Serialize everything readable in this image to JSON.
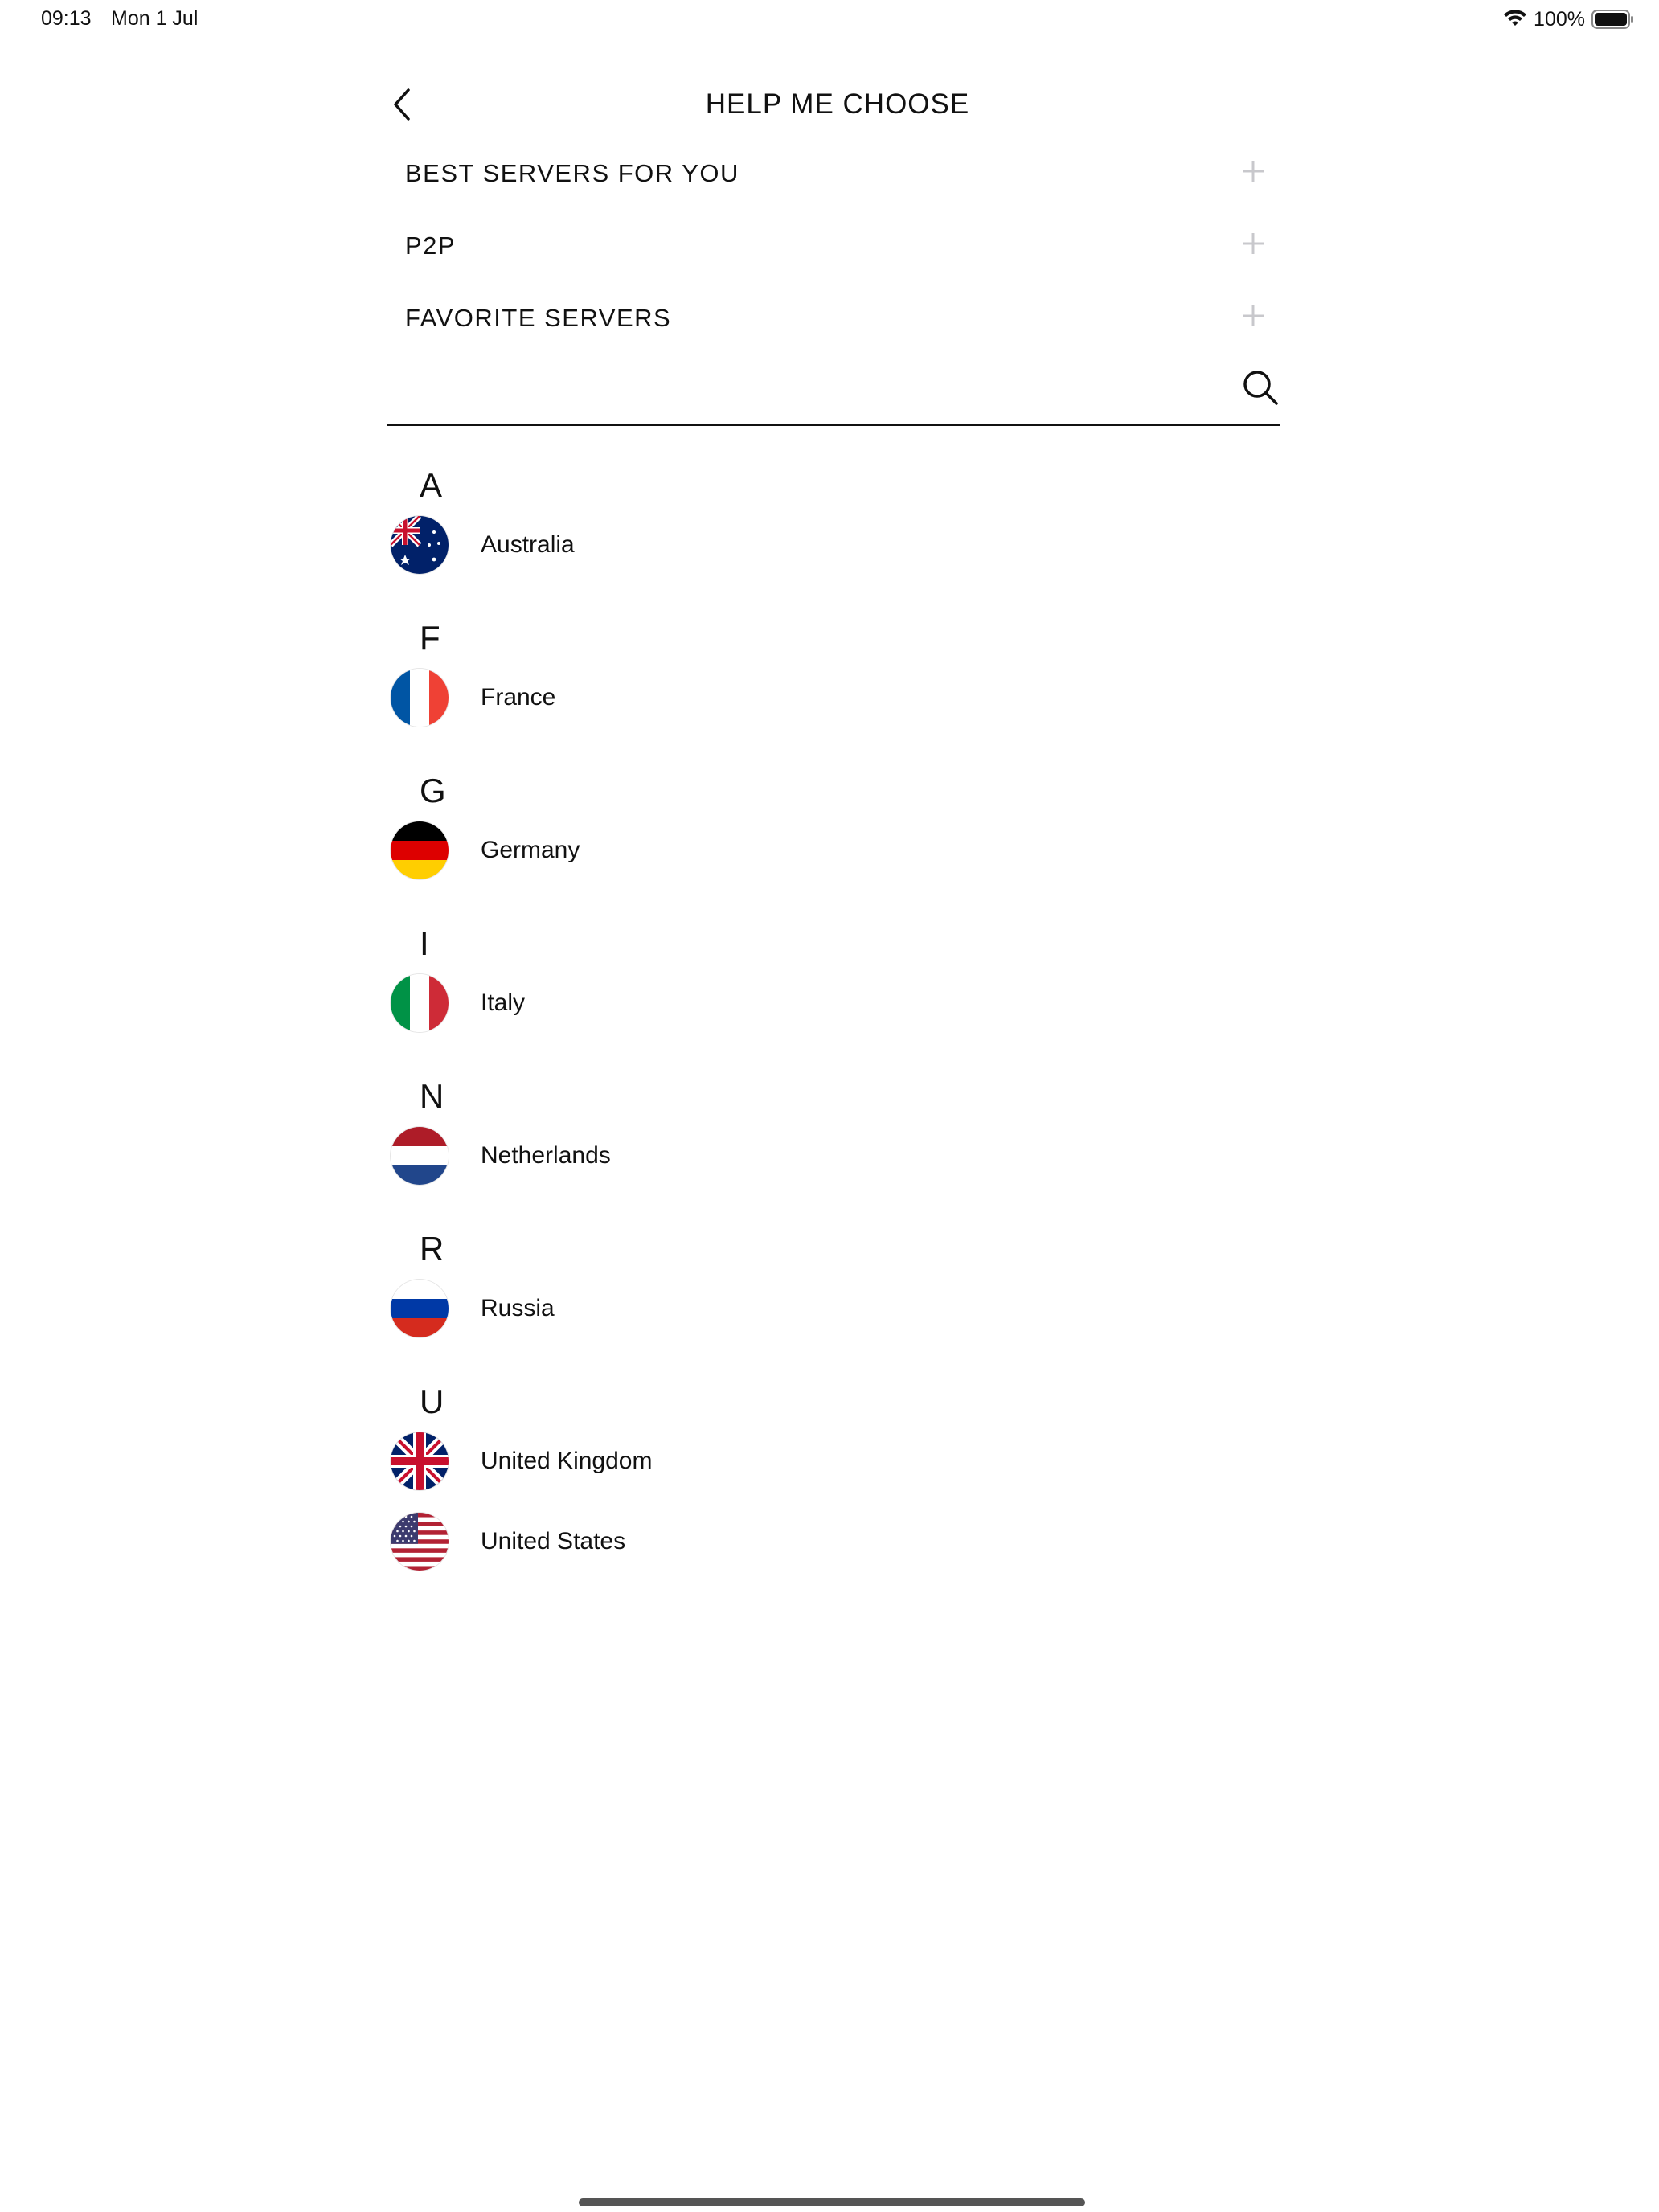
{
  "status_bar": {
    "time": "09:13",
    "date": "Mon 1 Jul",
    "battery": "100%"
  },
  "header": {
    "title": "HELP ME CHOOSE",
    "back_icon": "chevron-left-icon"
  },
  "sections": [
    {
      "label": "BEST SERVERS FOR YOU",
      "icon": "plus-icon"
    },
    {
      "label": "P2P",
      "icon": "plus-icon"
    },
    {
      "label": "FAVORITE SERVERS",
      "icon": "plus-icon"
    }
  ],
  "search": {
    "value": "",
    "placeholder": "",
    "icon": "search-icon"
  },
  "groups": [
    {
      "letter": "A",
      "countries": [
        {
          "name": "Australia",
          "flag": "au"
        }
      ]
    },
    {
      "letter": "F",
      "countries": [
        {
          "name": "France",
          "flag": "fr"
        }
      ]
    },
    {
      "letter": "G",
      "countries": [
        {
          "name": "Germany",
          "flag": "de"
        }
      ]
    },
    {
      "letter": "I",
      "countries": [
        {
          "name": "Italy",
          "flag": "it"
        }
      ]
    },
    {
      "letter": "N",
      "countries": [
        {
          "name": "Netherlands",
          "flag": "nl"
        }
      ]
    },
    {
      "letter": "R",
      "countries": [
        {
          "name": "Russia",
          "flag": "ru"
        }
      ]
    },
    {
      "letter": "U",
      "countries": [
        {
          "name": "United Kingdom",
          "flag": "gb"
        },
        {
          "name": "United States",
          "flag": "us"
        }
      ]
    }
  ],
  "colors": {
    "text": "#111111",
    "plus_icon": "#c8c8cc",
    "divider": "#111111",
    "home_indicator": "#555555"
  }
}
